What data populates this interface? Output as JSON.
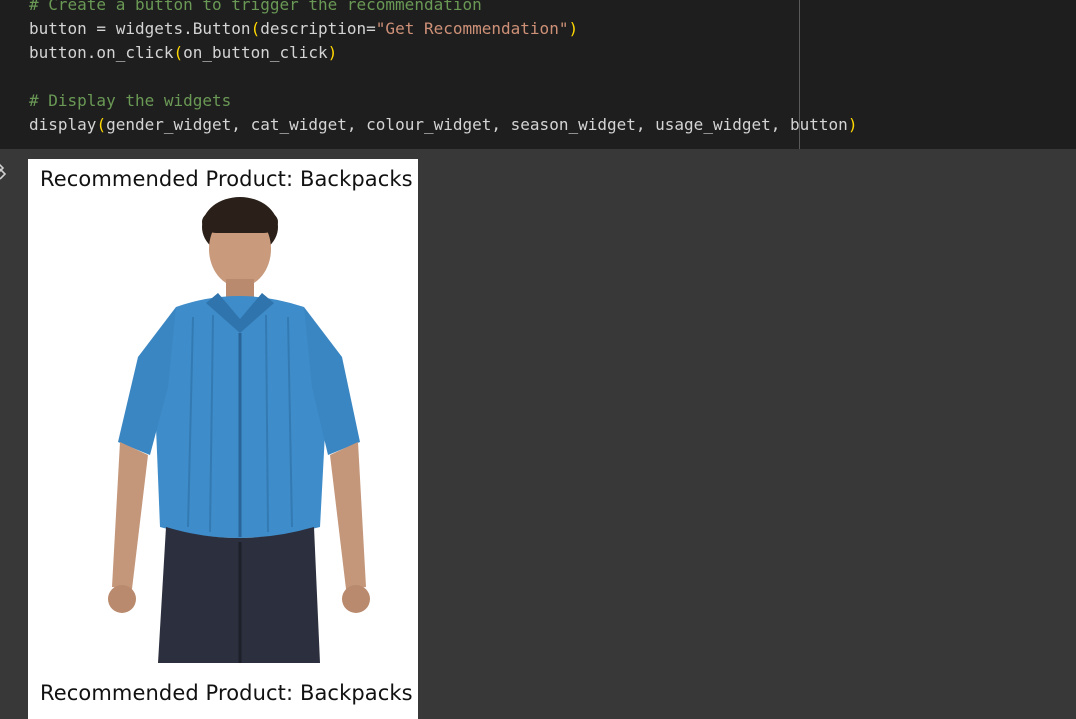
{
  "code": {
    "lines": [
      [
        {
          "t": "comment",
          "v": "# Create a button to trigger the recommendation"
        }
      ],
      [
        {
          "t": "plain",
          "v": "button = widgets.Button"
        },
        {
          "t": "paren",
          "v": "("
        },
        {
          "t": "plain",
          "v": "description="
        },
        {
          "t": "string",
          "v": "\"Get Recommendation\""
        },
        {
          "t": "paren",
          "v": ")"
        }
      ],
      [
        {
          "t": "plain",
          "v": "button.on_click"
        },
        {
          "t": "paren",
          "v": "("
        },
        {
          "t": "plain",
          "v": "on_button_click"
        },
        {
          "t": "paren",
          "v": ")"
        }
      ],
      [],
      [
        {
          "t": "comment",
          "v": "# Display the widgets"
        }
      ],
      [
        {
          "t": "plain",
          "v": "display"
        },
        {
          "t": "paren",
          "v": "("
        },
        {
          "t": "plain",
          "v": "gender_widget, cat_widget, colour_widget, season_widget, usage_widget, button"
        },
        {
          "t": "paren",
          "v": ")"
        }
      ]
    ]
  },
  "output": {
    "toggle_icon": "output-toggle-icon",
    "figure_title_top": "Recommended Product: Backpacks",
    "figure_title_bottom": "Recommended Product: Backpacks",
    "image_icon": "product-photo-man-blue-shirt"
  }
}
